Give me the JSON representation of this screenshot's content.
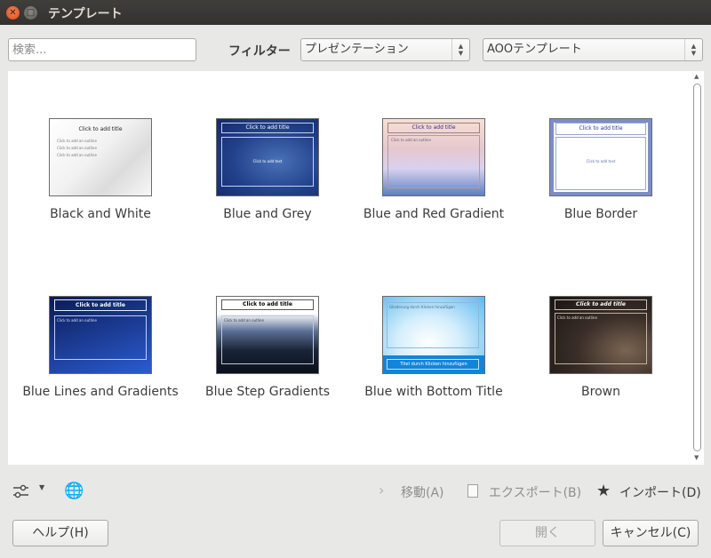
{
  "window": {
    "title": "テンプレート"
  },
  "search": {
    "placeholder": "検索..."
  },
  "filter": {
    "label": "フィルター",
    "type_value": "プレゼンテーション",
    "category_value": "AOOテンプレート"
  },
  "templates": [
    {
      "name": "Black and White",
      "title_text": "Click to add title",
      "body_text": "Click to add an outline"
    },
    {
      "name": "Blue and Grey",
      "title_text": "Click to add title",
      "body_text": "Click to add text"
    },
    {
      "name": "Blue and Red Gradient",
      "title_text": "Click to add title",
      "body_text": "Click to add an outline"
    },
    {
      "name": "Blue Border",
      "title_text": "Click to add title",
      "body_text": "Click to add text"
    },
    {
      "name": "Blue Lines and Gradients",
      "title_text": "Click to add title",
      "body_text": "Click to add an outline"
    },
    {
      "name": "Blue Step Gradients",
      "title_text": "Click to add title",
      "body_text": "Click to add an outline"
    },
    {
      "name": "Blue with Bottom Title",
      "title_text": "Titel durch Klicken hinzufügen",
      "body_text": "Gliederung durch Klicken hinzufügen"
    },
    {
      "name": "Brown",
      "title_text": "Click to add title",
      "body_text": "Click to add an outline"
    }
  ],
  "toolbar": {
    "move_label": "移動(A)",
    "export_label": "エクスポート(B)",
    "import_label": "インポート(D)"
  },
  "buttons": {
    "help": "ヘルプ(H)",
    "open": "開く",
    "cancel": "キャンセル(C)"
  }
}
